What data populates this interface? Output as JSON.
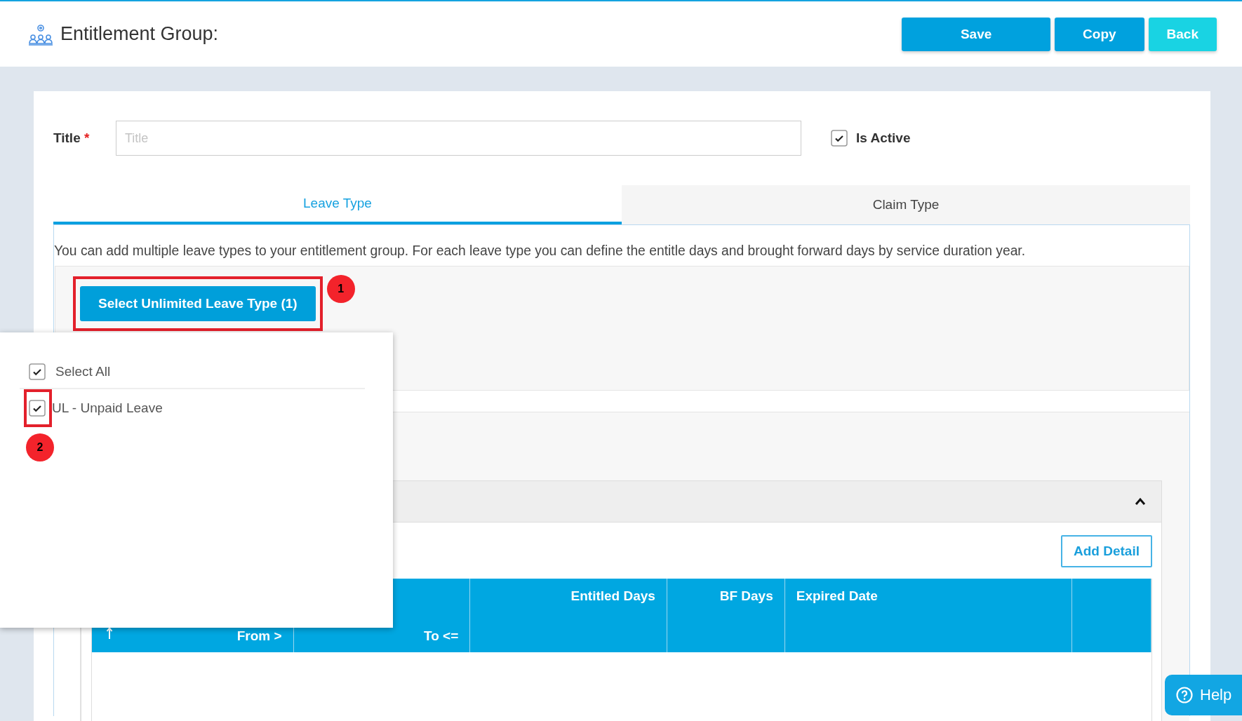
{
  "header": {
    "title": "Entitlement Group:",
    "buttons": [
      {
        "label": "Save",
        "kind": "primary"
      },
      {
        "label": "Copy",
        "kind": "primary"
      },
      {
        "label": "Back",
        "kind": "accent"
      }
    ]
  },
  "form": {
    "title_label": "Title",
    "required_mark": "*",
    "title_field": {
      "placeholder": "Title"
    },
    "is_active": {
      "label": "Is Active",
      "checked": true
    }
  },
  "tabs": [
    {
      "label": "Leave Type",
      "selected": true
    },
    {
      "label": "Claim Type",
      "selected": false
    }
  ],
  "description": "You can add multiple leave types to your entitlement group. For each leave type you can define the entitle days and brought forward days by service duration year.",
  "select_button": {
    "label": "Select Unlimited Leave Type (1)",
    "annotation": "1"
  },
  "dropdown": {
    "select_all": {
      "label": "Select All",
      "checked": true
    },
    "options": [
      {
        "label": "UL - Unpaid Leave",
        "checked": true,
        "annotation": "2"
      }
    ]
  },
  "section": {
    "expanded": true
  },
  "add_detail": "Add Detail",
  "table": {
    "columns": [
      {
        "label": "From >",
        "kind": "range",
        "sort_icon": true
      },
      {
        "label": "To <=",
        "kind": "range"
      },
      {
        "label": "Entitled Days",
        "kind": "number"
      },
      {
        "label": "BF Days",
        "kind": "number"
      },
      {
        "label": "Expired Date",
        "kind": "text"
      },
      {
        "kind": "blank"
      }
    ]
  },
  "help": {
    "label": "Help"
  }
}
